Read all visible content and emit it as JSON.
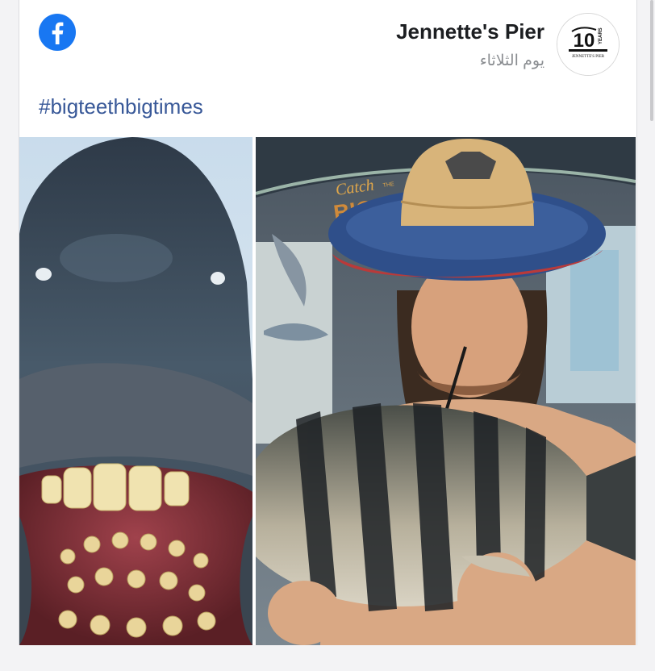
{
  "post": {
    "page_name": "Jennette's Pier",
    "time": "يوم الثلاثاء",
    "hashtag": "#bigteethbigtimes"
  },
  "logo": {
    "number": "10",
    "years": "YEARS",
    "name": "JENNETTE'S PIER"
  },
  "photo_right": {
    "sign_line1": "Catch",
    "sign_line1_small": "THE",
    "sign_line2": "BIG ONES"
  },
  "icons": {
    "app": "facebook-icon"
  },
  "colors": {
    "facebook_blue": "#1877f2",
    "hashtag_blue": "#385898",
    "name_text": "#1c1e21",
    "meta_text": "#8a8d91"
  }
}
